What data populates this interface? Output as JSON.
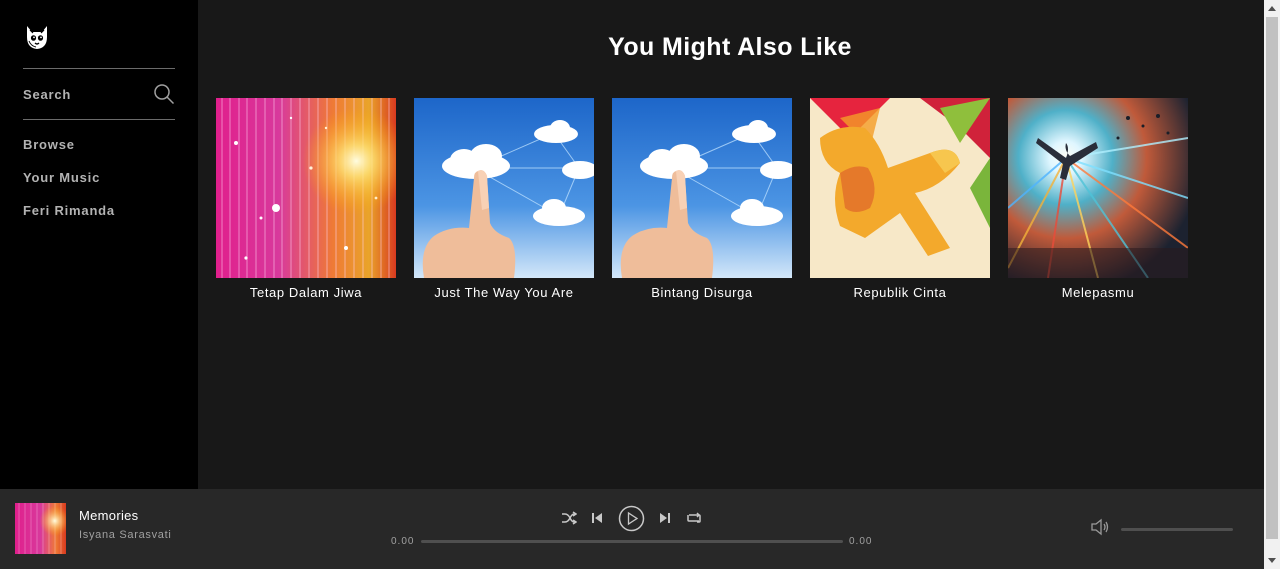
{
  "sidebar": {
    "logo": "fox-logo-icon",
    "search": {
      "label": "Search",
      "icon": "search-icon"
    },
    "items": [
      {
        "label": "Browse"
      },
      {
        "label": "Your Music"
      },
      {
        "label": "Feri Rimanda"
      }
    ]
  },
  "main": {
    "title": "You Might Also Like",
    "cards": [
      {
        "title": "Tetap Dalam Jiwa",
        "art": "pink-orange-light-streaks"
      },
      {
        "title": "Just The Way You Are",
        "art": "finger-touching-cloud-network"
      },
      {
        "title": "Bintang Disurga",
        "art": "finger-touching-cloud-network"
      },
      {
        "title": "Republik Cinta",
        "art": "orange-running-figure"
      },
      {
        "title": "Melepasmu",
        "art": "figure-in-light-burst"
      }
    ]
  },
  "player": {
    "track_title": "Memories",
    "artist": "Isyana Sarasvati",
    "art": "pink-orange-light-streaks",
    "time_elapsed": "0.00",
    "time_total": "0.00",
    "progress": 0,
    "volume": 0,
    "controls": [
      "shuffle-icon",
      "previous-icon",
      "play-icon",
      "next-icon",
      "repeat-icon"
    ],
    "volume_icon": "speaker-icon"
  },
  "colors": {
    "sidebar_bg": "#000000",
    "main_bg": "#181818",
    "player_bg": "#282828",
    "text_primary": "#ffffff",
    "text_secondary": "#b3b3b3"
  }
}
